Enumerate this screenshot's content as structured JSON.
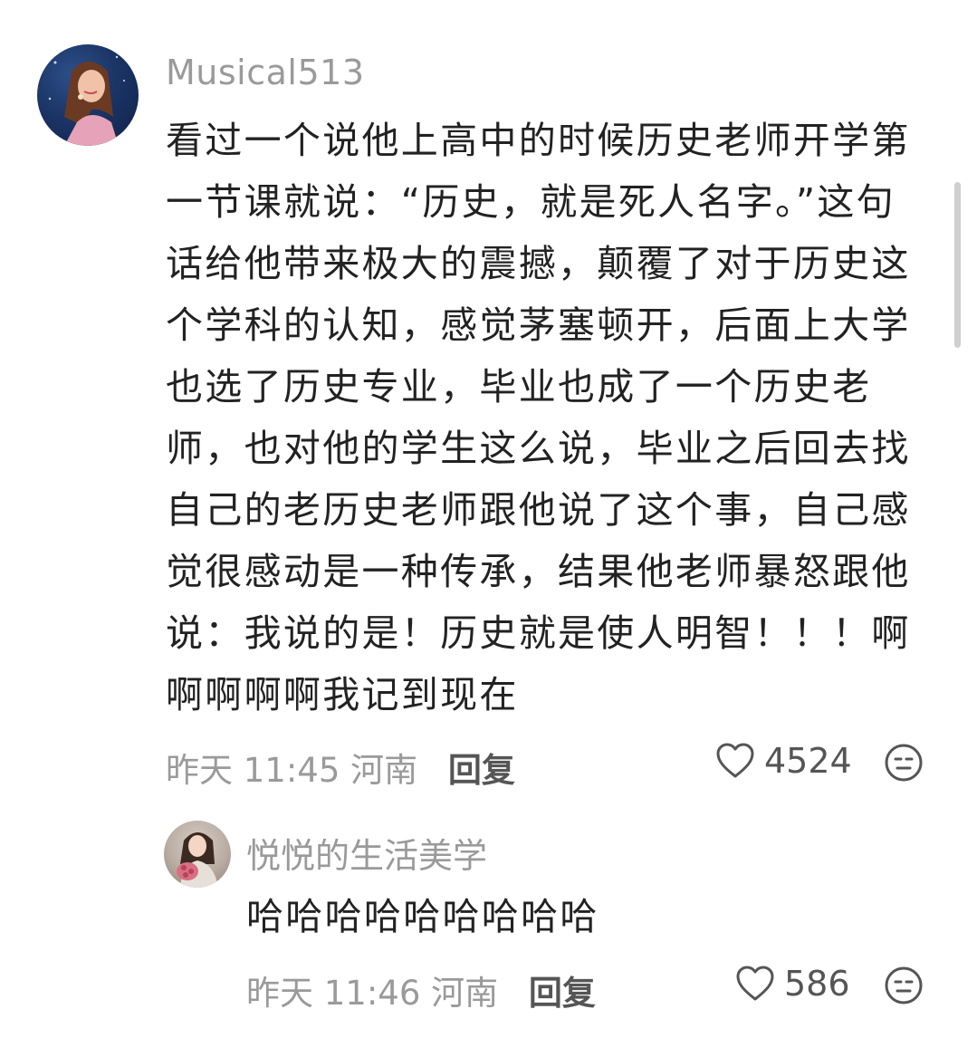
{
  "comment": {
    "username": "Musical513",
    "text": "看过一个说他上高中的时候历史老师开学第一节课就说：“历史，就是死人名字。”这句话给他带来极大的震撼，颠覆了对于历史这个学科的认知，感觉茅塞顿开，后面上大学也选了历史专业，毕业也成了一个历史老师，也对他的学生这么说，毕业之后回去找自己的老历史老师跟他说了这个事，自己感觉很感动是一种传承，结果他老师暴怒跟他说：我说的是！历史就是使人明智！！！啊啊啊啊啊我记到现在",
    "time": "昨天 11:45",
    "location": "河南",
    "reply_label": "回复",
    "likes": "4524"
  },
  "reply": {
    "username": "悦悦的生活美学",
    "text": "哈哈哈哈哈哈哈哈哈",
    "time": "昨天 11:46",
    "location": "河南",
    "reply_label": "回复",
    "likes": "586"
  },
  "icons": {
    "like": "heart-outline-icon",
    "emoji": "emoji-face-icon"
  }
}
